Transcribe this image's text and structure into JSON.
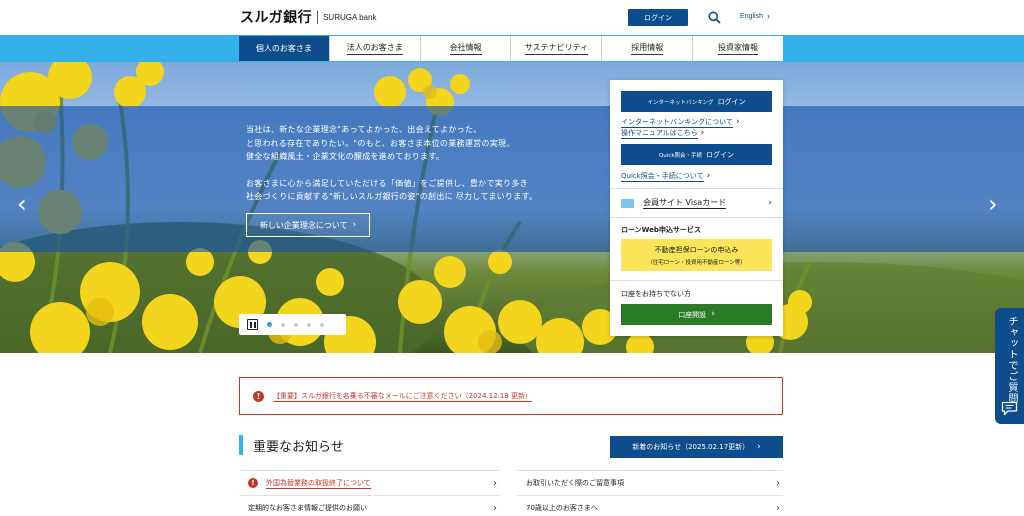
{
  "header": {
    "logo_jp": "スルガ銀行",
    "logo_en": "SURUGA bank",
    "login_label": "ログイン",
    "english_label": "English"
  },
  "nav": {
    "items": [
      {
        "label": "個人のお客さま"
      },
      {
        "label": "法人のお客さま"
      },
      {
        "label": "会社情報"
      },
      {
        "label": "サステナビリティ"
      },
      {
        "label": "採用情報"
      },
      {
        "label": "投資家情報"
      }
    ]
  },
  "hero": {
    "paragraph1": [
      "当社は、新たな企業理念\"あってよかった、出会えてよかった、",
      "と思われる存在でありたい。\"のもと、お客さま本位の業務運営の実現、",
      "健全な組織風土・企業文化の醸成を進めております。"
    ],
    "paragraph2": [
      "お客さまに心から満足していただける「価値」をご提供し、豊かで実り多き",
      "社会づくりに貢献する\"新しいスルガ銀行の姿\"の創出に 尽力してまいります。"
    ],
    "button_label": "新しい企業理念について",
    "slide_count": 5,
    "active_slide": 1
  },
  "panel": {
    "ib_login": {
      "small": "インターネットバンキング",
      "main": "ログイン"
    },
    "ib_link": "インターネットバンキングについて",
    "manual_link": "操作マニュアルはこちら",
    "quick_login": {
      "small": "Quick照会・手続",
      "main": "ログイン"
    },
    "quick_link": "Quick照会・手続について",
    "visa_card": "会員サイト Visaカード",
    "loan_heading": "ローンWeb申込サービス",
    "loan_button": {
      "main": "不動産担保ローンの申込み",
      "sub": "（住宅ローン・投資用不動産ローン等）"
    },
    "account_heading": "口座をお持ちでない方",
    "account_button": "口座開設"
  },
  "chat": {
    "label": "チャットでご質問"
  },
  "alert": {
    "text": "【重要】スルガ銀行を名乗る不審なメールにご注意ください（2024.12.18 更新）"
  },
  "news": {
    "title": "重要なお知らせ",
    "latest_button": "新着のお知らせ（2025.02.17更新）",
    "items_left": [
      {
        "text": "外国為替業務の取扱終了について",
        "important": true
      },
      {
        "text": "定期的なお客さま情報ご提供のお願い",
        "important": false
      }
    ],
    "items_right": [
      {
        "text": "お取引いただく際のご留意事項",
        "important": false
      },
      {
        "text": "70歳以上のお客さまへ",
        "important": false
      }
    ]
  },
  "colors": {
    "primary": "#0e4d8d",
    "nav_bar": "#33b1e8",
    "alert": "#c0392b",
    "green": "#2a7a26",
    "yellow": "#fbe55a"
  }
}
